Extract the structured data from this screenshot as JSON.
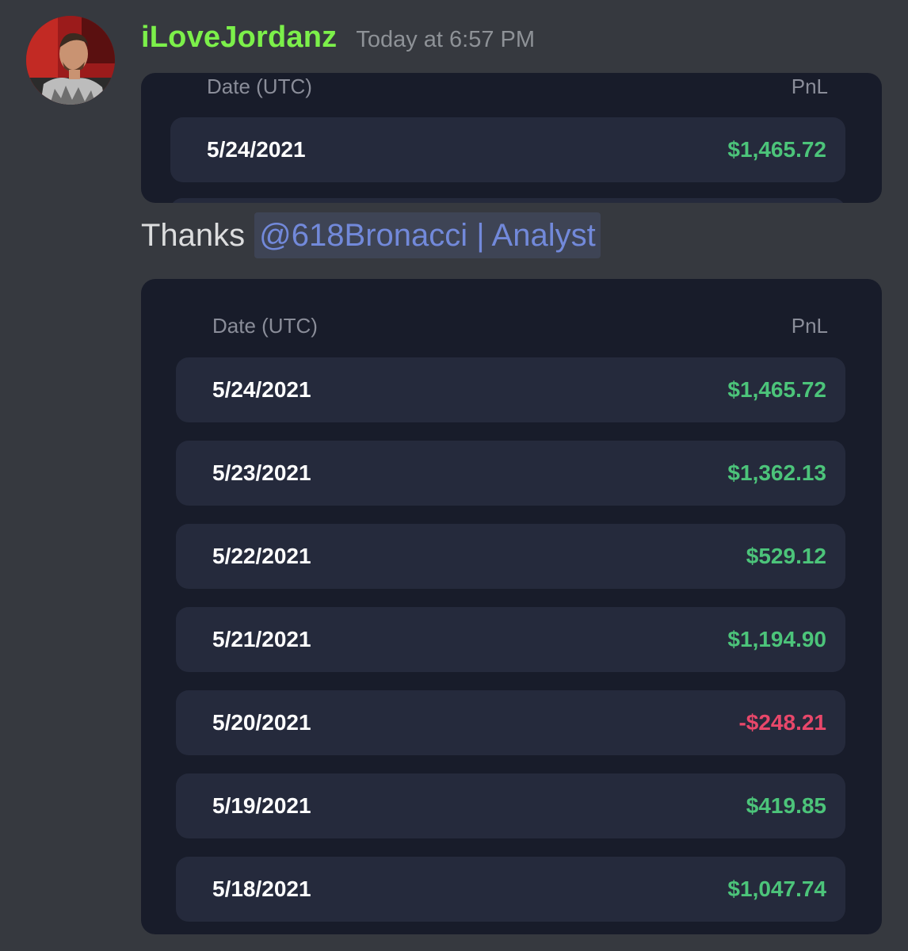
{
  "message": {
    "username": "iLoveJordanz",
    "timestamp": "Today at 6:57 PM",
    "avatar_icon": "user-avatar"
  },
  "card_top": {
    "header_date": "Date (UTC)",
    "header_pnl": "PnL",
    "rows": [
      {
        "date": "5/24/2021",
        "pnl": "$1,465.72"
      }
    ]
  },
  "thanks": {
    "text": "Thanks",
    "mention": "@618Bronacci | Analyst"
  },
  "card_main": {
    "header_date": "Date (UTC)",
    "header_pnl": "PnL",
    "rows": [
      {
        "date": "5/24/2021",
        "pnl": "$1,465.72"
      },
      {
        "date": "5/23/2021",
        "pnl": "$1,362.13"
      },
      {
        "date": "5/22/2021",
        "pnl": "$529.12"
      },
      {
        "date": "5/21/2021",
        "pnl": "$1,194.90"
      },
      {
        "date": "5/20/2021",
        "pnl": "-$248.21"
      },
      {
        "date": "5/19/2021",
        "pnl": "$419.85"
      },
      {
        "date": "5/18/2021",
        "pnl": "$1,047.74"
      }
    ]
  },
  "colors": {
    "username": "#7cf04a",
    "positive": "#4cc47a",
    "negative": "#e8476a",
    "mention": "#7289da"
  }
}
